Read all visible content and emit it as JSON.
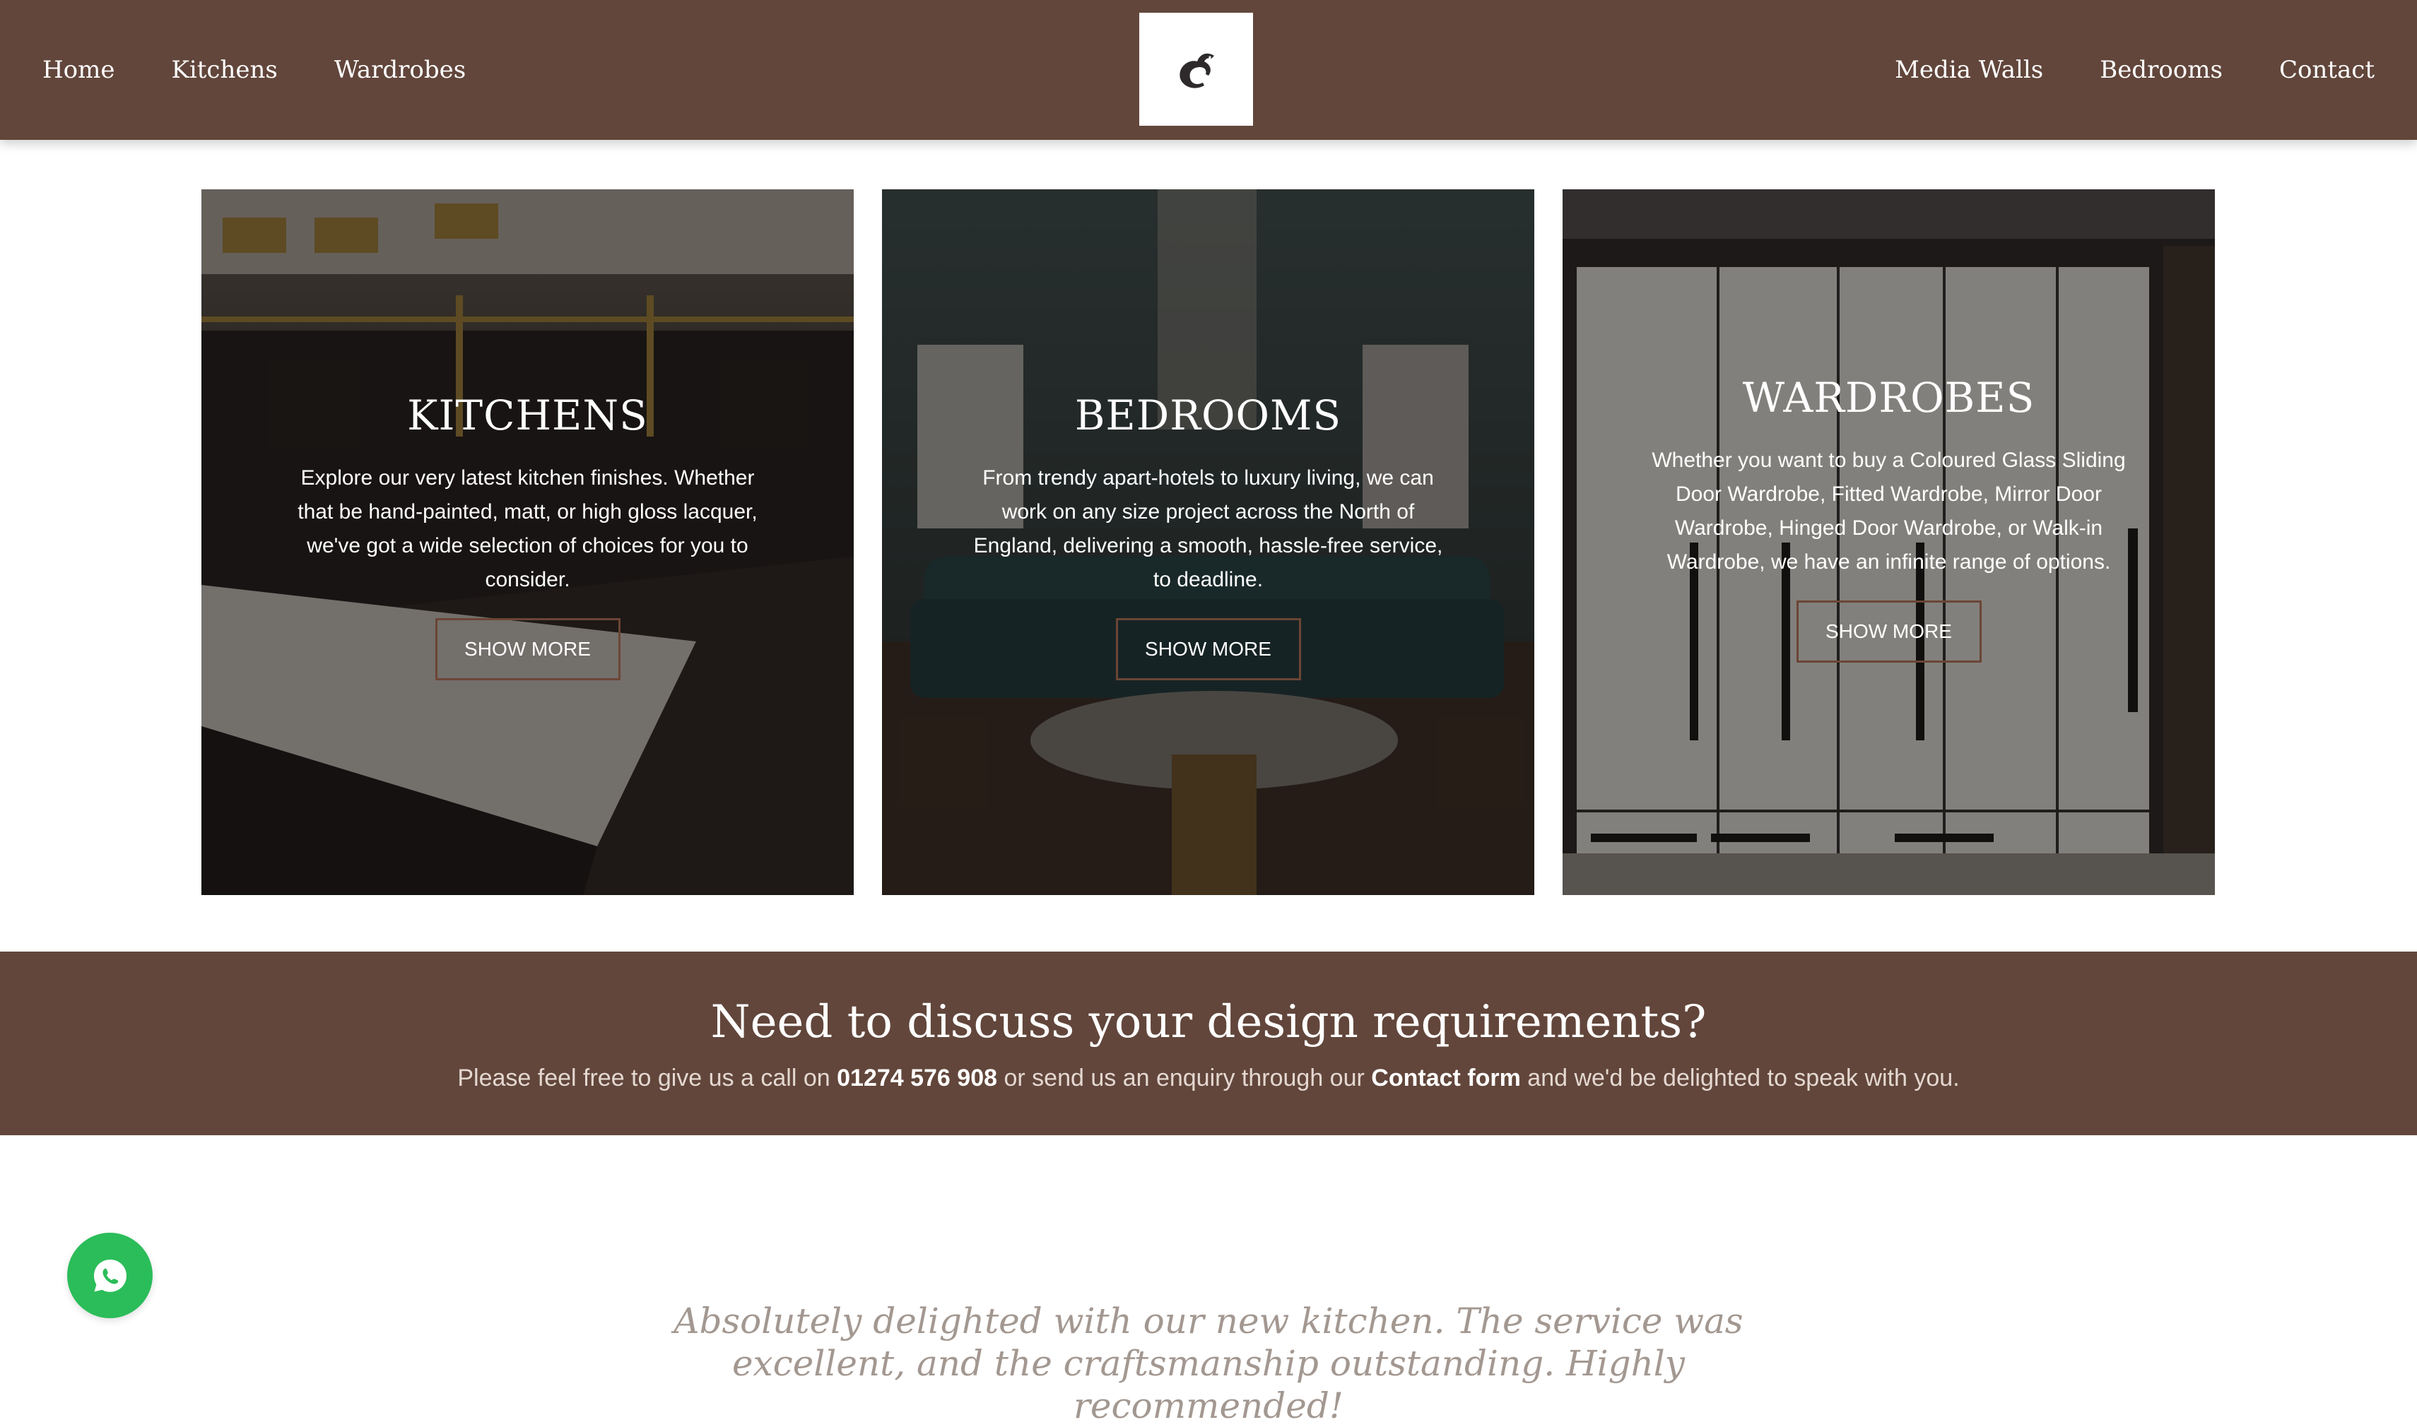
{
  "header": {
    "nav_left": [
      "Home",
      "Kitchens",
      "Wardrobes"
    ],
    "nav_right": [
      "Media Walls",
      "Bedrooms",
      "Contact"
    ],
    "logo_icon": "horse-logo-icon"
  },
  "cards": [
    {
      "title": "KITCHENS",
      "text": "Explore our very latest kitchen finishes. Whether that be hand-painted, matt, or high gloss lacquer, we've got a wide selection of choices for you to consider.",
      "button": "SHOW MORE"
    },
    {
      "title": "BEDROOMS",
      "text": "From trendy apart-hotels to luxury living, we can work on any size project across the North of England, delivering a smooth, hassle-free service, to deadline.",
      "button": "SHOW MORE"
    },
    {
      "title": "WARDROBES",
      "text": "Whether you want to buy a Coloured Glass Sliding Door Wardrobe, Fitted Wardrobe, Mirror Door Wardrobe, Hinged Door Wardrobe, or Walk-in Wardrobe, we have an infinite range of options.",
      "button": "SHOW MORE"
    }
  ],
  "cta": {
    "heading": "Need to discuss your design requirements?",
    "text_1": "Please feel free to give us a call on",
    "phone": "01274 576 908",
    "text_2": "or send us an enquiry through our",
    "link": "Contact form",
    "text_3": "and we'd be delighted to speak with you."
  },
  "whatsapp": {
    "icon": "whatsapp-icon"
  },
  "testimonial": {
    "text": "Absolutely delighted with our new kitchen. The service was excellent, and the craftsmanship outstanding. Highly recommended!"
  },
  "colors": {
    "brand_brown": "#62463b",
    "button_border": "#6b4535",
    "whatsapp_green": "#2bbd5a",
    "testimonial_grey": "#a39891"
  }
}
